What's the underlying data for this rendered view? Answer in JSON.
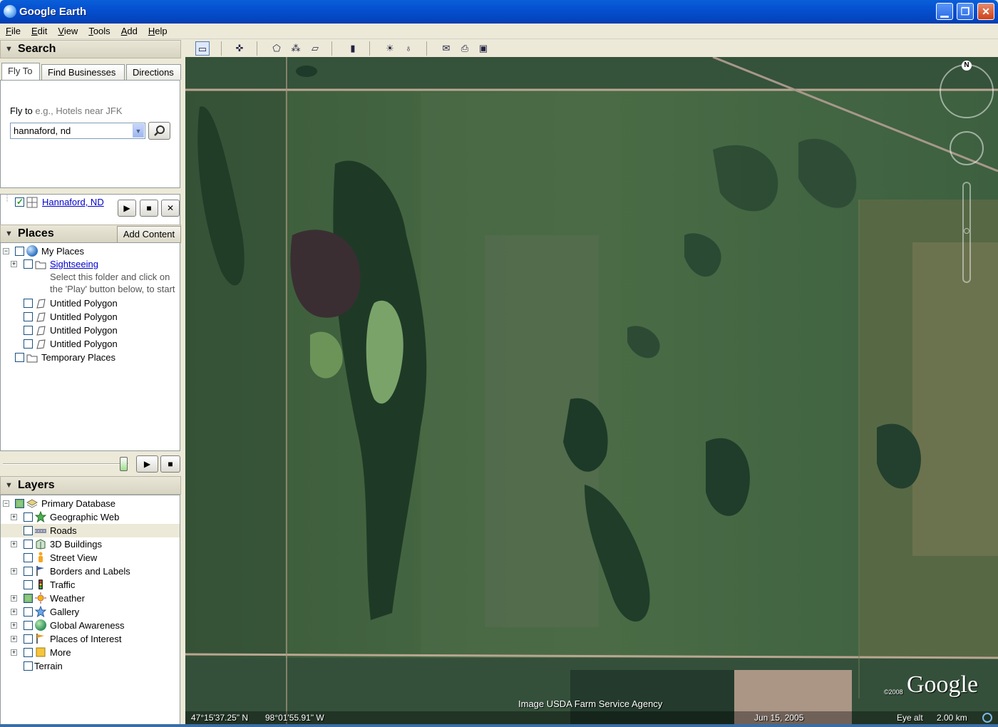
{
  "window": {
    "title": "Google Earth",
    "min_icon": "minimize-icon",
    "max_icon": "maximize-icon",
    "close_icon": "close-icon"
  },
  "menu": [
    "File",
    "Edit",
    "View",
    "Tools",
    "Add",
    "Help"
  ],
  "search": {
    "header": "Search",
    "tabs": [
      "Fly To",
      "Find Businesses",
      "Directions"
    ],
    "fly_label": "Fly to",
    "fly_placeholder": "e.g., Hotels near JFK",
    "fly_value": "hannaford, nd",
    "result": "Hannaford, ND"
  },
  "places": {
    "header": "Places",
    "add_content": "Add Content",
    "items": {
      "my_places": "My Places",
      "sightseeing": "Sightseeing",
      "hint1": "Select this folder and click on",
      "hint2": "the 'Play' button below, to start",
      "poly1": "Untitled Polygon",
      "poly2": "Untitled Polygon",
      "poly3": "Untitled Polygon",
      "poly4": "Untitled Polygon",
      "temp": "Temporary Places"
    }
  },
  "layers": {
    "header": "Layers",
    "items": [
      "Primary Database",
      "Geographic Web",
      "Roads",
      "3D Buildings",
      "Street View",
      "Borders and Labels",
      "Traffic",
      "Weather",
      "Gallery",
      "Global Awareness",
      "Places of Interest",
      "More",
      "Terrain"
    ]
  },
  "map": {
    "credit": "Image USDA Farm Service Agency",
    "lat": "47°15'37.25\" N",
    "lon": "98°01'55.91\" W",
    "date": "Jun 15, 2005",
    "eye_alt_label": "Eye alt",
    "eye_alt_value": "2.00 km",
    "copyright": "©2008",
    "brand": "Google",
    "north": "N"
  },
  "colors": {
    "title_bar": "#0550d0",
    "panel": "#ece9d8",
    "link": "#0000cc",
    "map_base": "#3f5e3c"
  }
}
